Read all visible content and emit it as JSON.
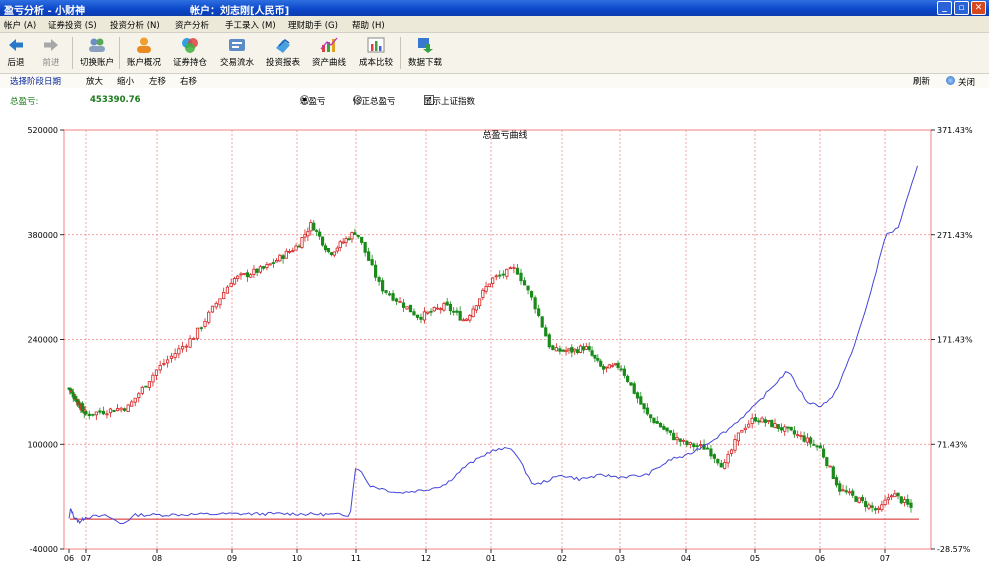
{
  "window": {
    "title": "盈亏分析 - 小财神",
    "account": "帐户：刘志刚[人民币]"
  },
  "menu": [
    "帐户 (A)",
    "证券投资 (S)",
    "投资分析 (N)",
    "资产分析",
    "手工录入 (M)",
    "理财助手 (G)",
    "帮助 (H)"
  ],
  "toolbar": {
    "back": "后退",
    "forward": "前进",
    "switch_account": "切换账户",
    "account_overview": "账户概况",
    "holdings": "证券持仓",
    "transactions": "交易流水",
    "report": "投资报表",
    "asset_curve": "资产曲线",
    "cost_compare": "成本比较",
    "download": "数据下载"
  },
  "subbar": {
    "select_period": "选择阶段日期",
    "zoom_in": "放大",
    "zoom_out": "缩小",
    "left": "左移",
    "right": "右移",
    "refresh": "刷新",
    "close": "关闭"
  },
  "summary": {
    "label": "总盈亏:",
    "value": "453390.76",
    "opt_total": "总盈亏",
    "opt_adjusted": "修正总盈亏",
    "show_index": "显示上证指数",
    "selected": "总盈亏",
    "show_index_checked": true
  },
  "colors": {
    "up": "#d62020",
    "down": "#1a8a1a",
    "line": "#4646d8",
    "grid": "#f08080",
    "value": "#1a7a1a"
  },
  "chart_data": {
    "type": "candlestick+line",
    "title": "总盈亏曲线",
    "x_ticks": [
      "06",
      "07",
      "08",
      "09",
      "10",
      "11",
      "12",
      "01",
      "02",
      "03",
      "04",
      "05",
      "06",
      "07"
    ],
    "y_left_ticks": [
      "520000",
      "380000",
      "240000",
      "100000",
      "-40000"
    ],
    "y_right_ticks": [
      "371.43%",
      "271.43%",
      "171.43%",
      "71.43%",
      "-28.57%"
    ],
    "ylim_left": [
      -40000,
      520000
    ],
    "ylim_right": [
      -28.57,
      371.43
    ],
    "candle_close_anchors": [
      {
        "x": 6.0,
        "y": 175000
      },
      {
        "x": 7.0,
        "y": 140000
      },
      {
        "x": 7.6,
        "y": 150000
      },
      {
        "x": 8.0,
        "y": 200000
      },
      {
        "x": 8.5,
        "y": 245000
      },
      {
        "x": 9.0,
        "y": 320000
      },
      {
        "x": 9.5,
        "y": 335000
      },
      {
        "x": 10.0,
        "y": 365000
      },
      {
        "x": 10.25,
        "y": 395000
      },
      {
        "x": 10.55,
        "y": 355000
      },
      {
        "x": 11.0,
        "y": 385000
      },
      {
        "x": 11.35,
        "y": 310000
      },
      {
        "x": 11.9,
        "y": 270000
      },
      {
        "x": 12.3,
        "y": 285000
      },
      {
        "x": 12.6,
        "y": 265000
      },
      {
        "x": 13.0,
        "y": 320000
      },
      {
        "x": 13.35,
        "y": 335000
      },
      {
        "x": 13.6,
        "y": 290000
      },
      {
        "x": 13.85,
        "y": 225000
      },
      {
        "x": 14.2,
        "y": 225000
      },
      {
        "x": 14.4,
        "y": 230000
      },
      {
        "x": 14.7,
        "y": 200000
      },
      {
        "x": 15.0,
        "y": 205000
      },
      {
        "x": 15.4,
        "y": 140000
      },
      {
        "x": 15.8,
        "y": 110000
      },
      {
        "x": 16.0,
        "y": 100000
      },
      {
        "x": 16.3,
        "y": 95000
      },
      {
        "x": 16.55,
        "y": 70000
      },
      {
        "x": 16.8,
        "y": 120000
      },
      {
        "x": 17.0,
        "y": 135000
      },
      {
        "x": 17.3,
        "y": 125000
      },
      {
        "x": 17.7,
        "y": 110000
      },
      {
        "x": 18.0,
        "y": 95000
      },
      {
        "x": 18.3,
        "y": 40000
      },
      {
        "x": 18.6,
        "y": 25000
      },
      {
        "x": 18.9,
        "y": 10000
      },
      {
        "x": 19.1,
        "y": 35000
      },
      {
        "x": 19.4,
        "y": 15000
      }
    ],
    "line_anchors": [
      {
        "x": 6.0,
        "y": 0
      },
      {
        "x": 6.1,
        "y": 10
      },
      {
        "x": 6.3,
        "y": 2
      },
      {
        "x": 6.6,
        "y": -3
      },
      {
        "x": 7.0,
        "y": 2
      },
      {
        "x": 7.3,
        "y": 3
      },
      {
        "x": 7.5,
        "y": -5
      },
      {
        "x": 7.7,
        "y": 4
      },
      {
        "x": 8.0,
        "y": 4
      },
      {
        "x": 9.0,
        "y": 5
      },
      {
        "x": 10.0,
        "y": 5
      },
      {
        "x": 10.9,
        "y": 4
      },
      {
        "x": 11.0,
        "y": 52
      },
      {
        "x": 11.2,
        "y": 32
      },
      {
        "x": 11.6,
        "y": 25
      },
      {
        "x": 12.0,
        "y": 28
      },
      {
        "x": 12.3,
        "y": 33
      },
      {
        "x": 12.6,
        "y": 50
      },
      {
        "x": 13.0,
        "y": 65
      },
      {
        "x": 13.3,
        "y": 68
      },
      {
        "x": 13.6,
        "y": 32
      },
      {
        "x": 14.0,
        "y": 42
      },
      {
        "x": 14.3,
        "y": 38
      },
      {
        "x": 14.7,
        "y": 42
      },
      {
        "x": 15.0,
        "y": 40
      },
      {
        "x": 15.4,
        "y": 42
      },
      {
        "x": 15.8,
        "y": 58
      },
      {
        "x": 16.0,
        "y": 60
      },
      {
        "x": 16.3,
        "y": 72
      },
      {
        "x": 16.6,
        "y": 85
      },
      {
        "x": 17.0,
        "y": 108
      },
      {
        "x": 17.5,
        "y": 142
      },
      {
        "x": 17.8,
        "y": 112
      },
      {
        "x": 18.0,
        "y": 108
      },
      {
        "x": 18.2,
        "y": 116
      },
      {
        "x": 18.5,
        "y": 160
      },
      {
        "x": 18.8,
        "y": 220
      },
      {
        "x": 19.0,
        "y": 270
      },
      {
        "x": 19.2,
        "y": 278
      },
      {
        "x": 19.5,
        "y": 336
      }
    ]
  }
}
